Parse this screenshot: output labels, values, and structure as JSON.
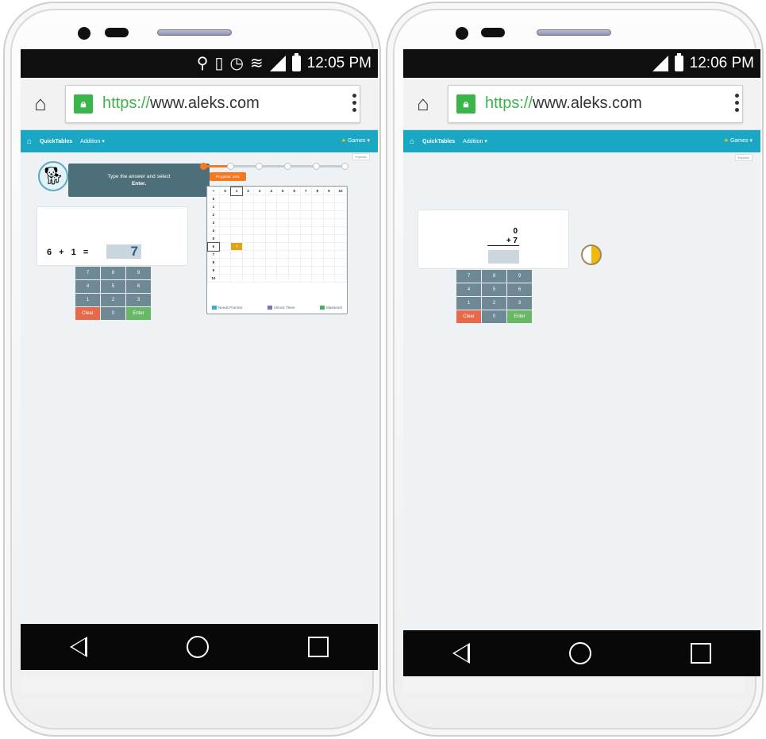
{
  "left": {
    "status": {
      "time": "12:05 PM"
    },
    "browser": {
      "url_protocol": "https://",
      "url_host": "www.aleks.com"
    },
    "nav": {
      "brand": "QuickTables",
      "menu": "Addition ▾",
      "games": "Games ▾"
    },
    "lang": "Español",
    "instruction": {
      "line1": "Type the answer and select",
      "line2": "Enter."
    },
    "equation": "6 + 1 =",
    "answer": "7",
    "progress": {
      "label": "Progress: 19%",
      "fraction": 0.19
    },
    "grid": {
      "header": [
        "+",
        "0",
        "1",
        "2",
        "3",
        "4",
        "5",
        "6",
        "7",
        "8",
        "9",
        "10"
      ],
      "selected": "7"
    },
    "legend": {
      "needs": "Needs Practice",
      "almost": "Almost There",
      "mastered": "Mastered!"
    }
  },
  "right": {
    "status": {
      "time": "12:06 PM"
    },
    "browser": {
      "url_protocol": "https://",
      "url_host": "www.aleks.com"
    },
    "nav": {
      "brand": "QuickTables",
      "menu": "Addition ▾",
      "games": "Games ▾"
    },
    "lang": "Español",
    "problem": {
      "top": "0",
      "bottom": "+ 7"
    }
  },
  "keypad": [
    "7",
    "8",
    "9",
    "4",
    "5",
    "6",
    "1",
    "2",
    "3",
    "Clear",
    "0",
    "Enter"
  ],
  "colors": {
    "navbar": "#19a7c4",
    "clear": "#e8694a",
    "enter": "#67b865",
    "progress": "#f47920"
  }
}
